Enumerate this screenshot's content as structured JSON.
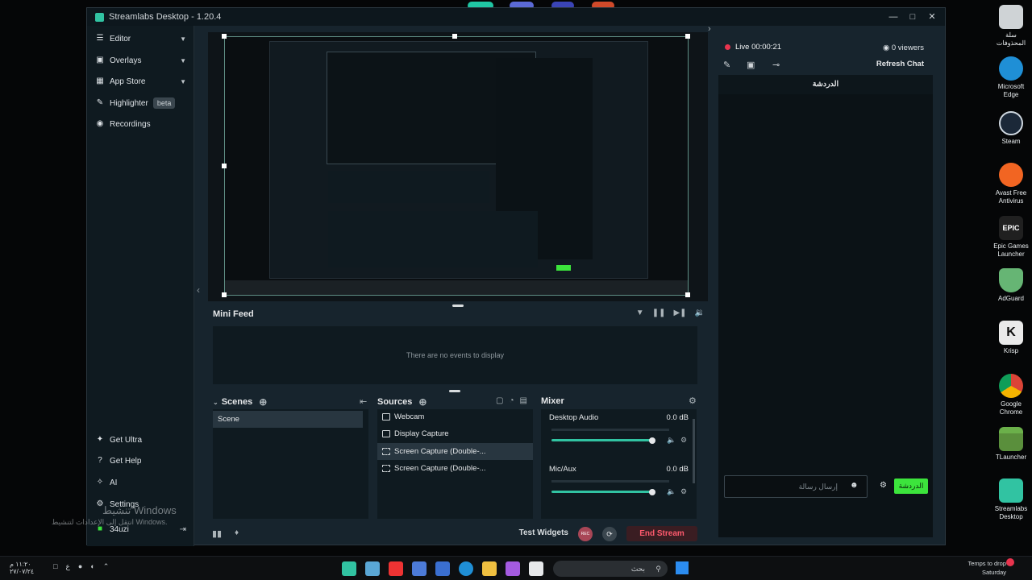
{
  "window": {
    "title": "Streamlabs Desktop - 1.20.4"
  },
  "sidebar": {
    "items": [
      {
        "label": "Editor"
      },
      {
        "label": "Overlays"
      },
      {
        "label": "App Store"
      },
      {
        "label": "Highlighter",
        "badge": "beta"
      },
      {
        "label": "Recordings"
      }
    ],
    "bottom": [
      {
        "label": "Get Ultra"
      },
      {
        "label": "Get Help"
      },
      {
        "label": "AI"
      },
      {
        "label": "Settings"
      },
      {
        "label": "34uzi"
      }
    ]
  },
  "minifeed": {
    "title": "Mini Feed",
    "empty": "There are no events to display"
  },
  "scenes": {
    "title": "Scenes",
    "items": [
      "Scene"
    ]
  },
  "sources": {
    "title": "Sources",
    "items": [
      "Webcam",
      "Display Capture",
      "Screen Capture (Double-...",
      "Screen Capture (Double-..."
    ]
  },
  "mixer": {
    "title": "Mixer",
    "channels": [
      {
        "name": "Desktop Audio",
        "db": "0.0 dB",
        "level": 1.0
      },
      {
        "name": "Mic/Aux",
        "db": "0.0 dB",
        "level": 1.0
      }
    ]
  },
  "bottombar": {
    "test_widgets": "Test Widgets",
    "rec": "REC",
    "end_stream": "End Stream"
  },
  "chat": {
    "live": "Live 00:00:21",
    "viewers": "0 viewers",
    "refresh": "Refresh Chat",
    "tab": "الدردشة",
    "input_placeholder": "إرسال رسالة",
    "send": "الدردشة"
  },
  "watermark": {
    "line1": "تنشيط Windows",
    "line2": "انتقل إلى الإعدادات لتنشيط Windows."
  },
  "desktop": {
    "icons": [
      {
        "label": "سلة المحذوفات",
        "color": "#d9d9d9"
      },
      {
        "label": "Microsoft Edge",
        "color": "#1f8fd6"
      },
      {
        "label": "Steam",
        "color": "#1b2838"
      },
      {
        "label": "Avast Free Antivirus",
        "color": "#f26522"
      },
      {
        "label": "Epic Games Launcher",
        "color": "#202020"
      },
      {
        "label": "AdGuard",
        "color": "#66b574"
      },
      {
        "label": "Krisp",
        "color": "#eaeaea"
      },
      {
        "label": "Google Chrome",
        "color": "#e6b41b"
      },
      {
        "label": "TLauncher",
        "color": "#5a8f3c"
      },
      {
        "label": "Streamlabs Desktop",
        "color": "#31c3a2"
      }
    ]
  },
  "taskbar": {
    "search": "بحث",
    "time": "Temps to drop",
    "date": "Saturday",
    "left_time": "١١:٢٠ م",
    "left_date": "٢٧/٠٧/٢٤"
  }
}
